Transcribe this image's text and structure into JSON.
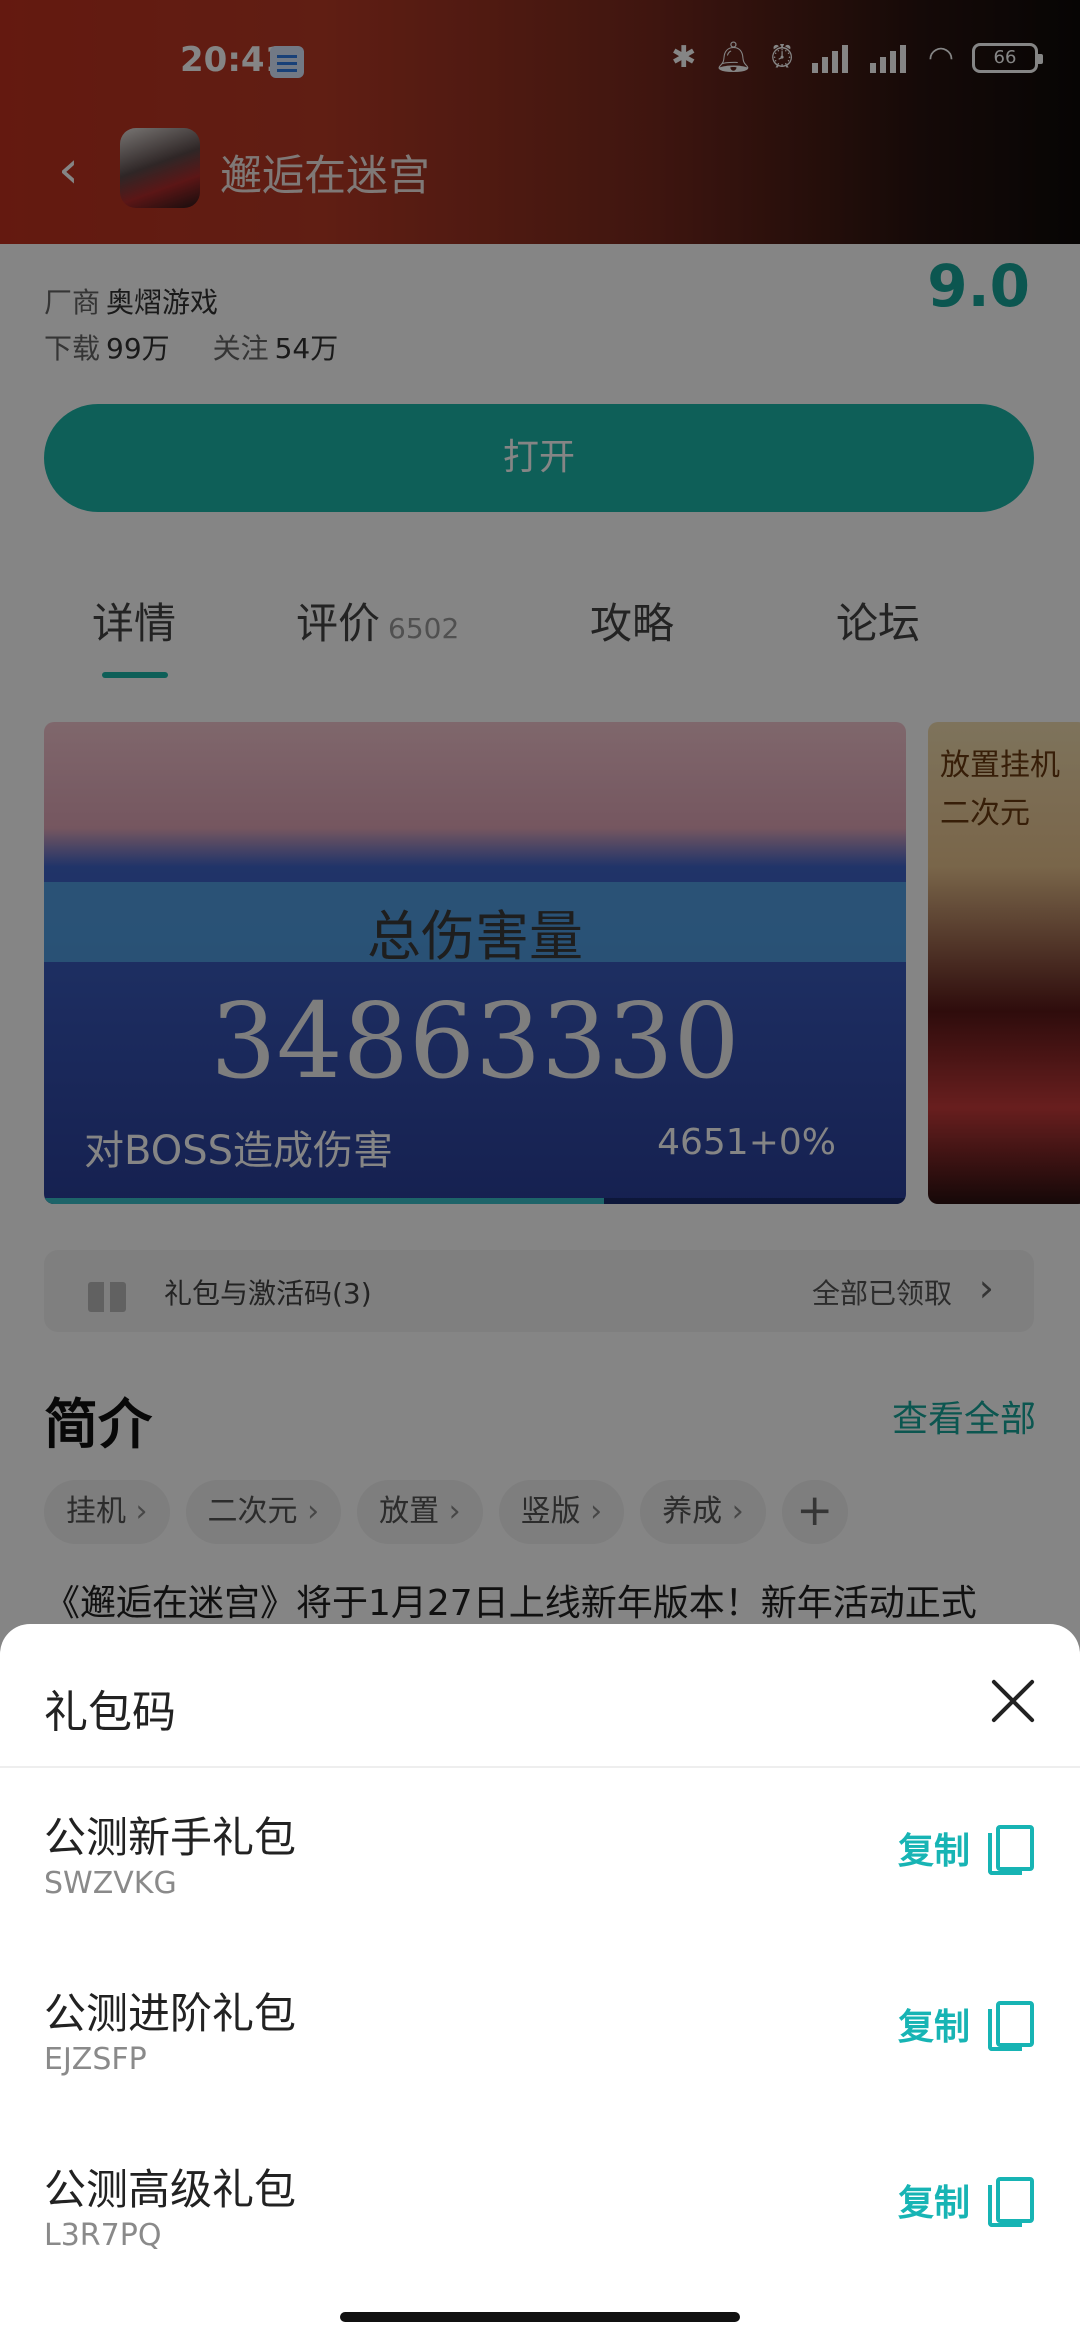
{
  "status_bar": {
    "time": "20:41",
    "battery": "66",
    "icons": [
      "message-icon",
      "bluetooth-icon",
      "bell-icon",
      "alarm-icon",
      "signal-icon",
      "signal-icon",
      "wifi-icon",
      "battery-icon"
    ]
  },
  "header": {
    "title": "邂逅在迷宫",
    "back_icon": "chevron-left-icon"
  },
  "app_info": {
    "vendor_label": "厂商",
    "vendor": "奥熠游戏",
    "downloads_label": "下载",
    "downloads": "99万",
    "follows_label": "关注",
    "follows": "54万",
    "score": "9.0"
  },
  "open_button": "打开",
  "tabs": [
    {
      "label": "详情",
      "count": ""
    },
    {
      "label": "评价",
      "count": "6502"
    },
    {
      "label": "攻略",
      "count": ""
    },
    {
      "label": "论坛",
      "count": ""
    }
  ],
  "screenshot": {
    "label": "总伤害量",
    "number": "34863330",
    "row_label": "对BOSS造成伤害",
    "row_value": "4651+0%",
    "side_text": "放置挂机 二次元",
    "progress": 0.65
  },
  "gift_row": {
    "label": "礼包与激活码(3)",
    "status": "全部已领取"
  },
  "intro": {
    "title": "简介",
    "view_all": "查看全部",
    "tags": [
      "挂机",
      "二次元",
      "放置",
      "竖版",
      "养成"
    ],
    "add_label": "+",
    "text": "《邂逅在迷宫》将于1月27日上线新年版本！新年活动正式"
  },
  "sheet": {
    "title": "礼包码",
    "items": [
      {
        "name": "公测新手礼包",
        "code": "SWZVKG",
        "copy_label": "复制"
      },
      {
        "name": "公测进阶礼包",
        "code": "EJZSFP",
        "copy_label": "复制"
      },
      {
        "name": "公测高级礼包",
        "code": "L3R7PQ",
        "copy_label": "复制"
      }
    ]
  },
  "colors": {
    "accent": "#17b4b4",
    "button": "#1bb7aa"
  }
}
